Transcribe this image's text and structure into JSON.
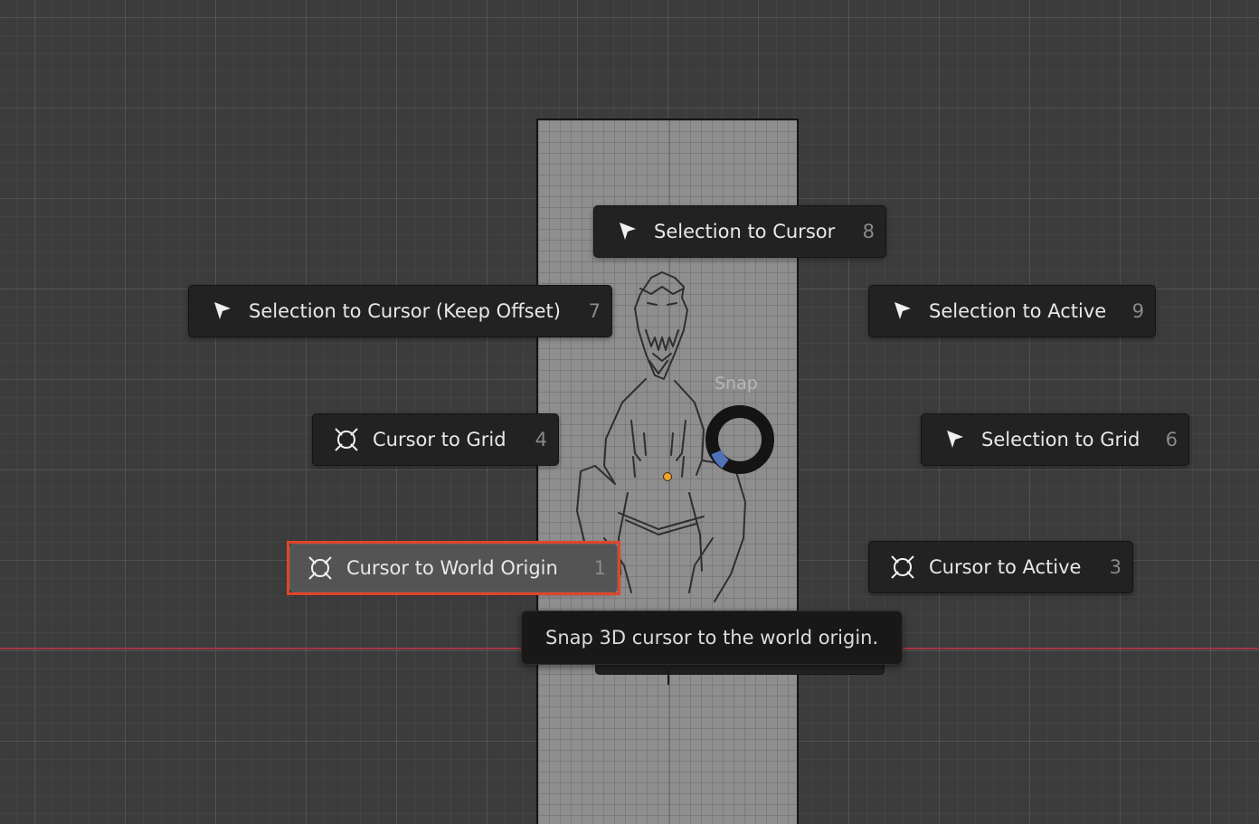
{
  "viewport": {
    "pie_menu": {
      "title": "Snap",
      "items": [
        {
          "label": "Selection to Cursor",
          "key": "8",
          "icon": "selection-cursor-icon"
        },
        {
          "label": "Selection to Cursor (Keep Offset)",
          "key": "7",
          "icon": "selection-cursor-icon"
        },
        {
          "label": "Selection to Active",
          "key": "9",
          "icon": "selection-cursor-icon"
        },
        {
          "label": "Cursor to Grid",
          "key": "4",
          "icon": "3d-cursor-icon"
        },
        {
          "label": "Selection to Grid",
          "key": "6",
          "icon": "selection-cursor-icon"
        },
        {
          "label": "Cursor to World Origin",
          "key": "1",
          "icon": "3d-cursor-icon",
          "active": true
        },
        {
          "label": "Cursor to Active",
          "key": "3",
          "icon": "3d-cursor-icon"
        }
      ]
    },
    "tooltip": {
      "text": "Snap 3D cursor to the world origin."
    }
  },
  "colors": {
    "highlight_outline": "#e0452b",
    "x_axis": "#a43545",
    "origin_dot": "#f0a030",
    "pie_direction": "#4d72b8"
  }
}
